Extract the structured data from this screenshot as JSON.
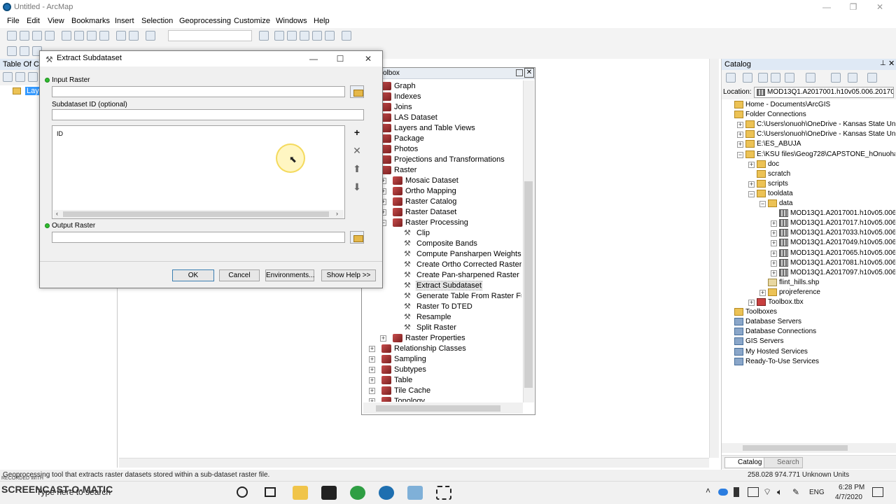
{
  "window": {
    "title": "Untitled - ArcMap",
    "controls": [
      "—",
      "❐",
      "✕"
    ]
  },
  "menu": [
    "File",
    "Edit",
    "View",
    "Bookmarks",
    "Insert",
    "Selection",
    "Geoprocessing",
    "Customize",
    "Windows",
    "Help"
  ],
  "toc": {
    "header": "Table Of Co",
    "layers_label": "Laye"
  },
  "dialog": {
    "title": "Extract Subdataset",
    "input_raster_label": "Input Raster",
    "input_raster_value": "",
    "subdataset_label": "Subdataset ID (optional)",
    "subdataset_value": "",
    "list_header": "ID",
    "output_raster_label": "Output Raster",
    "output_raster_value": "",
    "buttons": {
      "ok": "OK",
      "cancel": "Cancel",
      "environments": "Environments...",
      "show_help": "Show Help >>"
    }
  },
  "toolbox": {
    "header": "olbox",
    "items": [
      {
        "label": "Graph",
        "expander": "",
        "type": "toolset"
      },
      {
        "label": "Indexes",
        "expander": "",
        "type": "toolset"
      },
      {
        "label": "Joins",
        "expander": "",
        "type": "toolset"
      },
      {
        "label": "LAS Dataset",
        "expander": "",
        "type": "toolset"
      },
      {
        "label": "Layers and Table Views",
        "expander": "",
        "type": "toolset"
      },
      {
        "label": "Package",
        "expander": "",
        "type": "toolset"
      },
      {
        "label": "Photos",
        "expander": "",
        "type": "toolset"
      },
      {
        "label": "Projections and Transformations",
        "expander": "",
        "type": "toolset"
      },
      {
        "label": "Raster",
        "expander": "",
        "type": "toolset"
      },
      {
        "label": "Mosaic Dataset",
        "expander": "+",
        "type": "toolset",
        "indent": 1
      },
      {
        "label": "Ortho Mapping",
        "expander": "+",
        "type": "toolset",
        "indent": 1
      },
      {
        "label": "Raster Catalog",
        "expander": "+",
        "type": "toolset",
        "indent": 1
      },
      {
        "label": "Raster Dataset",
        "expander": "+",
        "type": "toolset",
        "indent": 1
      },
      {
        "label": "Raster Processing",
        "expander": "−",
        "type": "toolset",
        "indent": 1
      },
      {
        "label": "Clip",
        "expander": "",
        "type": "tool",
        "indent": 2
      },
      {
        "label": "Composite Bands",
        "expander": "",
        "type": "tool",
        "indent": 2
      },
      {
        "label": "Compute Pansharpen Weights",
        "expander": "",
        "type": "tool",
        "indent": 2
      },
      {
        "label": "Create Ortho Corrected Raster Da",
        "expander": "",
        "type": "tool",
        "indent": 2
      },
      {
        "label": "Create Pan-sharpened Raster Dat",
        "expander": "",
        "type": "tool",
        "indent": 2
      },
      {
        "label": "Extract Subdataset",
        "expander": "",
        "type": "tool",
        "indent": 2,
        "selected": true
      },
      {
        "label": "Generate Table From Raster Func",
        "expander": "",
        "type": "tool",
        "indent": 2
      },
      {
        "label": "Raster To DTED",
        "expander": "",
        "type": "tool",
        "indent": 2
      },
      {
        "label": "Resample",
        "expander": "",
        "type": "tool",
        "indent": 2
      },
      {
        "label": "Split Raster",
        "expander": "",
        "type": "tool",
        "indent": 2
      },
      {
        "label": "Raster Properties",
        "expander": "+",
        "type": "toolset",
        "indent": 1
      },
      {
        "label": "Relationship Classes",
        "expander": "+",
        "type": "toolset"
      },
      {
        "label": "Sampling",
        "expander": "+",
        "type": "toolset"
      },
      {
        "label": "Subtypes",
        "expander": "+",
        "type": "toolset"
      },
      {
        "label": "Table",
        "expander": "+",
        "type": "toolset"
      },
      {
        "label": "Tile Cache",
        "expander": "+",
        "type": "toolset"
      },
      {
        "label": "Topology",
        "expander": "+",
        "type": "toolset"
      }
    ]
  },
  "catalog": {
    "title": "Catalog",
    "location_label": "Location:",
    "location_value": "MOD13Q1.A2017001.h10v05.006.20170",
    "items": [
      {
        "label": "Home - Documents\\ArcGIS",
        "expander": "",
        "icon": "folder",
        "indent": 0
      },
      {
        "label": "Folder Connections",
        "expander": "",
        "icon": "folder",
        "indent": 0
      },
      {
        "label": "C:\\Users\\onuoh\\OneDrive - Kansas State Univer",
        "expander": "+",
        "icon": "folder",
        "indent": 1
      },
      {
        "label": "C:\\Users\\onuoh\\OneDrive - Kansas State Univer",
        "expander": "+",
        "icon": "folder",
        "indent": 1
      },
      {
        "label": "E:\\ES_ABUJA",
        "expander": "+",
        "icon": "folder",
        "indent": 1
      },
      {
        "label": "E:\\KSU files\\Geog728\\CAPSTONE_hOnuoha",
        "expander": "−",
        "icon": "folder",
        "indent": 1
      },
      {
        "label": "doc",
        "expander": "+",
        "icon": "folder",
        "indent": 2
      },
      {
        "label": "scratch",
        "expander": "",
        "icon": "folder",
        "indent": 2
      },
      {
        "label": "scripts",
        "expander": "+",
        "icon": "folder",
        "indent": 2
      },
      {
        "label": "tooldata",
        "expander": "−",
        "icon": "folder",
        "indent": 2
      },
      {
        "label": "data",
        "expander": "−",
        "icon": "folder",
        "indent": 3
      },
      {
        "label": "MOD13Q1.A2017001.h10v05.006.2017",
        "expander": "",
        "icon": "raster",
        "indent": 4
      },
      {
        "label": "MOD13Q1.A2017017.h10v05.006.2017",
        "expander": "+",
        "icon": "raster",
        "indent": 4
      },
      {
        "label": "MOD13Q1.A2017033.h10v05.006.2017",
        "expander": "+",
        "icon": "raster",
        "indent": 4
      },
      {
        "label": "MOD13Q1.A2017049.h10v05.006.2017",
        "expander": "+",
        "icon": "raster",
        "indent": 4
      },
      {
        "label": "MOD13Q1.A2017065.h10v05.006.2017",
        "expander": "+",
        "icon": "raster",
        "indent": 4
      },
      {
        "label": "MOD13Q1.A2017081.h10v05.006.2017",
        "expander": "+",
        "icon": "raster",
        "indent": 4
      },
      {
        "label": "MOD13Q1.A2017097.h10v05.006.2017",
        "expander": "+",
        "icon": "raster",
        "indent": 4
      },
      {
        "label": "flint_hills.shp",
        "expander": "",
        "icon": "shp",
        "indent": 3
      },
      {
        "label": "projreference",
        "expander": "+",
        "icon": "folder",
        "indent": 3
      },
      {
        "label": "Toolbox.tbx",
        "expander": "+",
        "icon": "tbx",
        "indent": 2
      },
      {
        "label": "Toolboxes",
        "expander": "",
        "icon": "folder",
        "indent": 0
      },
      {
        "label": "Database Servers",
        "expander": "",
        "icon": "db",
        "indent": 0
      },
      {
        "label": "Database Connections",
        "expander": "",
        "icon": "db",
        "indent": 0
      },
      {
        "label": "GIS Servers",
        "expander": "",
        "icon": "db",
        "indent": 0
      },
      {
        "label": "My Hosted Services",
        "expander": "",
        "icon": "db",
        "indent": 0
      },
      {
        "label": "Ready-To-Use Services",
        "expander": "",
        "icon": "db",
        "indent": 0
      }
    ],
    "tabs": [
      "Catalog",
      "Search"
    ]
  },
  "status": {
    "message": "Geoprocessing tool that extracts raster datasets stored within a sub-dataset raster file.",
    "coords": "258.028  974.771 Unknown Units"
  },
  "taskbar": {
    "search_text": "Type here to search",
    "language": "ENG",
    "time": "6:28 PM",
    "date": "4/7/2020"
  },
  "watermark": {
    "line1": "RECORDED WITH",
    "line2": "SCREENCAST-O-MATIC"
  }
}
